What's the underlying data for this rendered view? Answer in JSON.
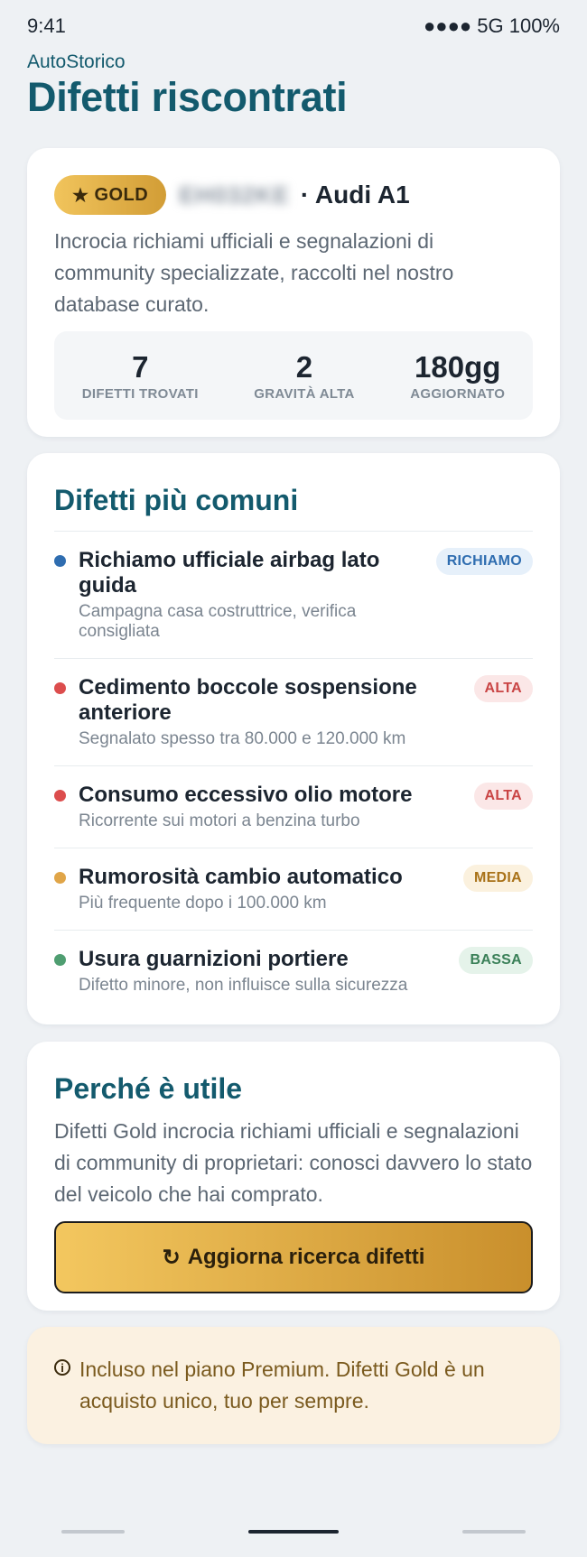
{
  "status_bar": {
    "time": "9:41",
    "signal": "●●●● 5G 100%"
  },
  "app": {
    "brand": "AutoStorico",
    "title": "Difetti riscontrati"
  },
  "summary": {
    "badge_icon": "star-icon",
    "badge_symbol": "★",
    "badge_label": "GOLD",
    "plate": "EH032KE",
    "car": "· Audi A1",
    "description": "Incrocia richiami ufficiali e segnalazioni di community specializzate, raccolti nel nostro database curato.",
    "stats": [
      {
        "value": "7",
        "label": "DIFETTI TROVATI"
      },
      {
        "value": "2",
        "label": "GRAVITÀ ALTA"
      },
      {
        "value": "180gg",
        "label": "AGGIORNATO"
      }
    ]
  },
  "defects": {
    "title": "Difetti più comuni",
    "items": [
      {
        "title": "Richiamo ufficiale airbag lato guida",
        "subtitle": "Campagna casa costruttrice, verifica consigliata",
        "tag": "RICHIAMO",
        "dot_color": "#2f6db0",
        "tag_bg": "#e6f0fa",
        "tag_color": "#2f6db0"
      },
      {
        "title": "Cedimento boccole sospensione anteriore",
        "subtitle": "Segnalato spesso tra 80.000 e 120.000 km",
        "tag": "ALTA",
        "dot_color": "#dc4d4d",
        "tag_bg": "#fbe7e7",
        "tag_color": "#c94444"
      },
      {
        "title": "Consumo eccessivo olio motore",
        "subtitle": "Ricorrente sui motori a benzina turbo",
        "tag": "ALTA",
        "dot_color": "#dc4d4d",
        "tag_bg": "#fbe7e7",
        "tag_color": "#c94444"
      },
      {
        "title": "Rumorosità cambio automatico",
        "subtitle": "Più frequente dopo i 100.000 km",
        "tag": "MEDIA",
        "dot_color": "#e0a548",
        "tag_bg": "#fbf1de",
        "tag_color": "#a97218"
      },
      {
        "title": "Usura guarnizioni portiere",
        "subtitle": "Difetto minore, non influisce sulla sicurezza",
        "tag": "BASSA",
        "dot_color": "#4f9e71",
        "tag_bg": "#e5f3ea",
        "tag_color": "#3a8058"
      }
    ]
  },
  "why": {
    "title": "Perché è utile",
    "text": "Difetti Gold incrocia richiami ufficiali e segnalazioni di community di proprietari: conosci davvero lo stato del veicolo che hai comprato.",
    "button_icon": "↻",
    "button_label": "Aggiorna ricerca difetti"
  },
  "info": {
    "icon": "info-icon",
    "icon_symbol": "i",
    "text": "Incluso nel piano Premium. Difetti Gold è un acquisto unico, tuo per sempre."
  }
}
